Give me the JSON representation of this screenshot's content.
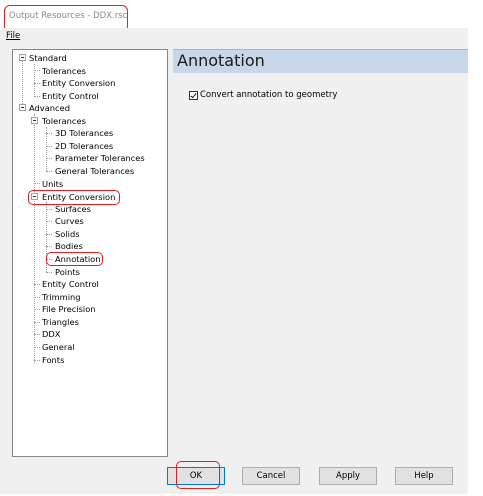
{
  "window": {
    "title": "Output Resources - DDX.rsc"
  },
  "menu": {
    "file": "File"
  },
  "tree": {
    "standard": "Standard",
    "standard_tolerances": "Tolerances",
    "standard_entity_conversion": "Entity Conversion",
    "standard_entity_control": "Entity Control",
    "advanced": "Advanced",
    "adv_tolerances": "Tolerances",
    "adv_3d_tolerances": "3D Tolerances",
    "adv_2d_tolerances": "2D Tolerances",
    "adv_parameter_tolerances": "Parameter Tolerances",
    "adv_general_tolerances": "General Tolerances",
    "units": "Units",
    "entity_conversion": "Entity Conversion",
    "surfaces": "Surfaces",
    "curves": "Curves",
    "solids": "Solids",
    "bodies": "Bodies",
    "annotation": "Annotation",
    "points": "Points",
    "entity_control": "Entity Control",
    "trimming": "Trimming",
    "file_precision": "File Precision",
    "triangles": "Triangles",
    "ddx": "DDX",
    "general": "General",
    "fonts": "Fonts"
  },
  "panel": {
    "title": "Annotation",
    "checkbox_label": "Convert annotation to geometry",
    "checkbox_checked": true
  },
  "buttons": {
    "ok": "OK",
    "cancel": "Cancel",
    "apply": "Apply",
    "help": "Help"
  },
  "colors": {
    "highlight": "#e02020",
    "panel_header": "#c7d7e9"
  }
}
